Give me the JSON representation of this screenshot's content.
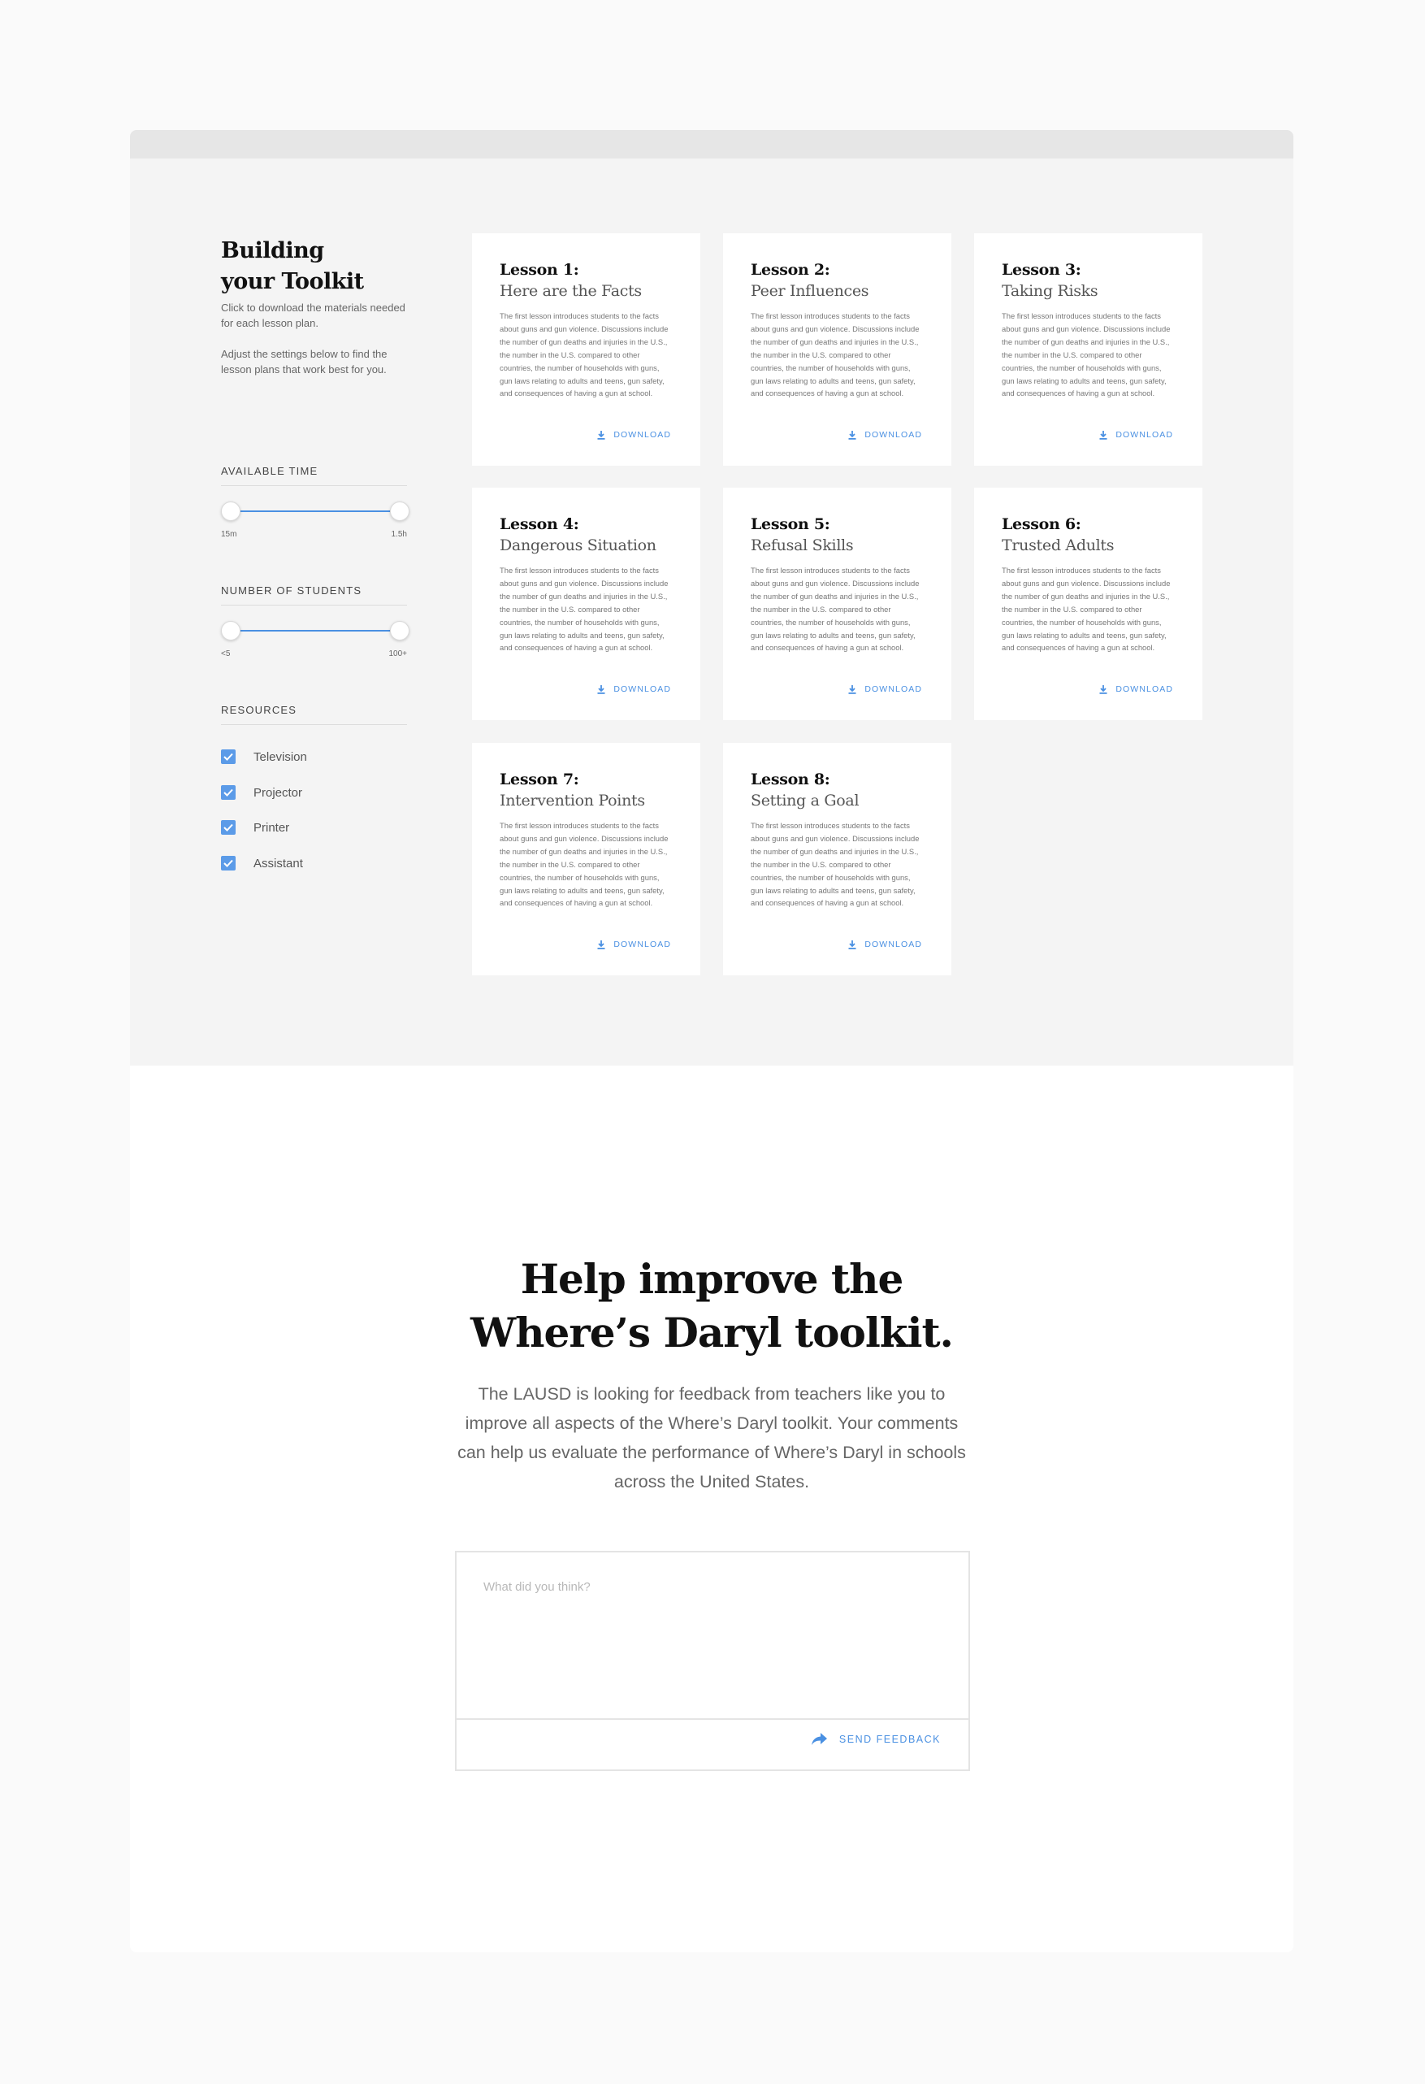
{
  "sidebar": {
    "title_line1": "Building",
    "title_line2": "your Toolkit",
    "intro1": "Click to download the materials needed for each lesson plan.",
    "intro2": "Adjust the settings below to find the lesson plans that work best for you.",
    "available_time": {
      "label": "AVAILABLE TIME",
      "min_label": "15m",
      "max_label": "1.5h"
    },
    "number_of_students": {
      "label": "NUMBER OF STUDENTS",
      "min_label": "<5",
      "max_label": "100+"
    },
    "resources": {
      "label": "RESOURCES",
      "items": [
        {
          "label": "Television",
          "checked": true
        },
        {
          "label": "Projector",
          "checked": true
        },
        {
          "label": "Printer",
          "checked": true
        },
        {
          "label": "Assistant",
          "checked": true
        }
      ]
    }
  },
  "lessons": [
    {
      "num": "Lesson 1:",
      "title": "Here are the Facts",
      "desc": "The first lesson introduces students to the facts about guns and gun violence. Discussions include the number of gun deaths and injuries in the U.S., the number in the U.S. compared to other countries, the number of households with guns, gun laws relating to adults and teens, gun safety, and consequences of having a gun at school.",
      "download": "DOWNLOAD"
    },
    {
      "num": "Lesson 2:",
      "title": "Peer Influences",
      "desc": "The first lesson introduces students to the facts about guns and gun violence. Discussions include the number of gun deaths and injuries in the U.S., the number in the U.S. compared to other countries, the number of households with guns, gun laws relating to adults and teens, gun safety, and consequences of having a gun at school.",
      "download": "DOWNLOAD"
    },
    {
      "num": "Lesson 3:",
      "title": "Taking Risks",
      "desc": "The first lesson introduces students to the facts about guns and gun violence. Discussions include the number of gun deaths and injuries in the U.S., the number in the U.S. compared to other countries, the number of households with guns, gun laws relating to adults and teens, gun safety, and consequences of having a gun at school.",
      "download": "DOWNLOAD"
    },
    {
      "num": "Lesson 4:",
      "title": "Dangerous Situation",
      "desc": "The first lesson introduces students to the facts about guns and gun violence. Discussions include the number of gun deaths and injuries in the U.S., the number in the U.S. compared to other countries, the number of households with guns, gun laws relating to adults and teens, gun safety, and consequences of having a gun at school.",
      "download": "DOWNLOAD"
    },
    {
      "num": "Lesson 5:",
      "title": "Refusal Skills",
      "desc": "The first lesson introduces students to the facts about guns and gun violence. Discussions include the number of gun deaths and injuries in the U.S., the number in the U.S. compared to other countries, the number of households with guns, gun laws relating to adults and teens, gun safety, and consequences of having a gun at school.",
      "download": "DOWNLOAD"
    },
    {
      "num": "Lesson 6:",
      "title": "Trusted Adults",
      "desc": "The first lesson introduces students to the facts about guns and gun violence. Discussions include the number of gun deaths and injuries in the U.S., the number in the U.S. compared to other countries, the number of households with guns, gun laws relating to adults and teens, gun safety, and consequences of having a gun at school.",
      "download": "DOWNLOAD"
    },
    {
      "num": "Lesson 7:",
      "title": "Intervention Points",
      "desc": "The first lesson introduces students to the facts about guns and gun violence. Discussions include the number of gun deaths and injuries in the U.S., the number in the U.S. compared to other countries, the number of households with guns, gun laws relating to adults and teens, gun safety, and consequences of having a gun at school.",
      "download": "DOWNLOAD"
    },
    {
      "num": "Lesson 8:",
      "title": "Setting a Goal",
      "desc": "The first lesson introduces students to the facts about guns and gun violence. Discussions include the number of gun deaths and injuries in the U.S., the number in the U.S. compared to other countries, the number of households with guns, gun laws relating to adults and teens, gun safety, and consequences of having a gun at school.",
      "download": "DOWNLOAD"
    }
  ],
  "feedback": {
    "heading_line1": "Help improve the",
    "heading_line2": "Where’s Daryl toolkit.",
    "body": "The LAUSD is looking for feedback from teachers like you to improve all aspects of the Where’s Daryl toolkit. Your comments can help us evaluate the performance of Where’s Daryl in schools across the United States.",
    "placeholder": "What did you think?",
    "send_label": "SEND FEEDBACK"
  },
  "colors": {
    "accent": "#4a90e2",
    "checkbox": "#5b9be8",
    "panel_bg": "#f4f4f4"
  },
  "icons": [
    "download-icon",
    "check-icon",
    "share-arrow-icon"
  ]
}
